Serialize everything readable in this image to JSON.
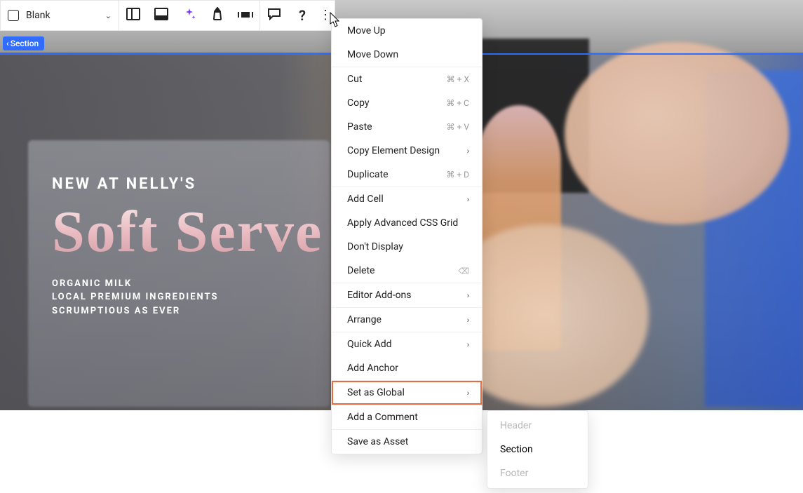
{
  "toolbar": {
    "select_label": "Blank"
  },
  "section_tag": "Section",
  "hero": {
    "eyebrow": "NEW AT NELLY'S",
    "title": "Soft Serve",
    "sub1": "ORGANIC MILK",
    "sub2": "LOCAL PREMIUM INGREDIENTS",
    "sub3": "SCRUMPTIOUS AS EVER"
  },
  "menu": {
    "move_up": "Move Up",
    "move_down": "Move Down",
    "cut": "Cut",
    "cut_sc": "⌘ + X",
    "copy": "Copy",
    "copy_sc": "⌘ + C",
    "paste": "Paste",
    "paste_sc": "⌘ + V",
    "copy_design": "Copy Element Design",
    "duplicate": "Duplicate",
    "duplicate_sc": "⌘ + D",
    "add_cell": "Add Cell",
    "css_grid": "Apply Advanced CSS Grid",
    "dont_display": "Don't Display",
    "delete": "Delete",
    "addons": "Editor Add-ons",
    "arrange": "Arrange",
    "quick_add": "Quick Add",
    "add_anchor": "Add Anchor",
    "set_global": "Set as Global",
    "add_comment": "Add a Comment",
    "save_asset": "Save as Asset"
  },
  "submenu": {
    "header": "Header",
    "section": "Section",
    "footer": "Footer"
  }
}
